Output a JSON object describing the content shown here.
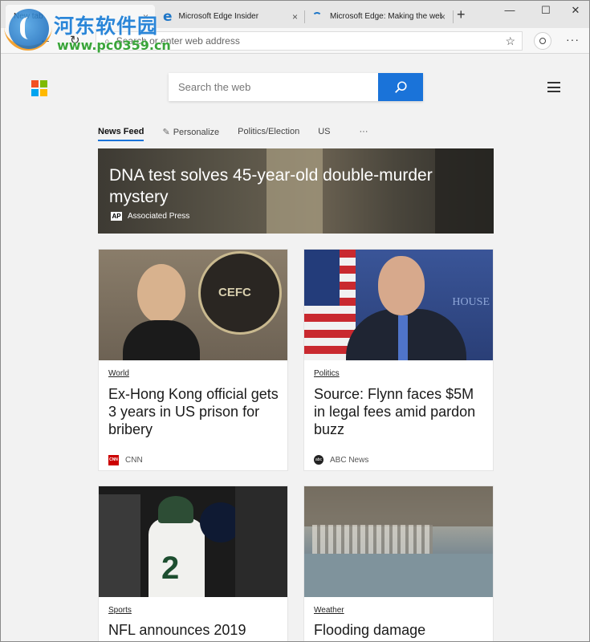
{
  "watermark": {
    "text_cn": "河东软件园",
    "url": "www.pc0359.cn"
  },
  "tabs": [
    {
      "title": "New tab",
      "close": "×"
    },
    {
      "title": "Microsoft Edge Insider",
      "close": "×"
    },
    {
      "title": "Microsoft Edge: Making the web",
      "close": "×"
    }
  ],
  "window_controls": {
    "new_tab": "+",
    "minimize": "—",
    "maximize": "☐",
    "close": "✕"
  },
  "toolbar": {
    "back": "←",
    "refresh": "↻",
    "address_placeholder": "Search or enter web address",
    "favorite": "☆",
    "more": "···"
  },
  "page": {
    "search_placeholder": "Search the web",
    "feed_tabs": [
      "News Feed",
      "Personalize",
      "Politics/Election",
      "US",
      "···"
    ],
    "hero": {
      "title": "DNA test solves 45-year-old double-murder mystery",
      "source": "Associated Press",
      "source_logo": "AP"
    },
    "cards": [
      {
        "category": "World",
        "title": "Ex-Hong Kong official gets 3 years in US prison for bribery",
        "source": "CNN",
        "source_logo": "CNN"
      },
      {
        "category": "Politics",
        "title": "Source: Flynn faces $5M in legal fees amid pardon buzz",
        "source": "ABC News",
        "source_logo": "abc"
      },
      {
        "category": "Sports",
        "title": "NFL announces 2019",
        "source": "",
        "source_logo": ""
      },
      {
        "category": "Weather",
        "title": "Flooding damage",
        "source": "",
        "source_logo": ""
      }
    ]
  },
  "colors": {
    "accent": "#1a73d9",
    "ms_red": "#f25022",
    "ms_green": "#7fba00",
    "ms_blue": "#00a4ef",
    "ms_yellow": "#ffb900"
  }
}
